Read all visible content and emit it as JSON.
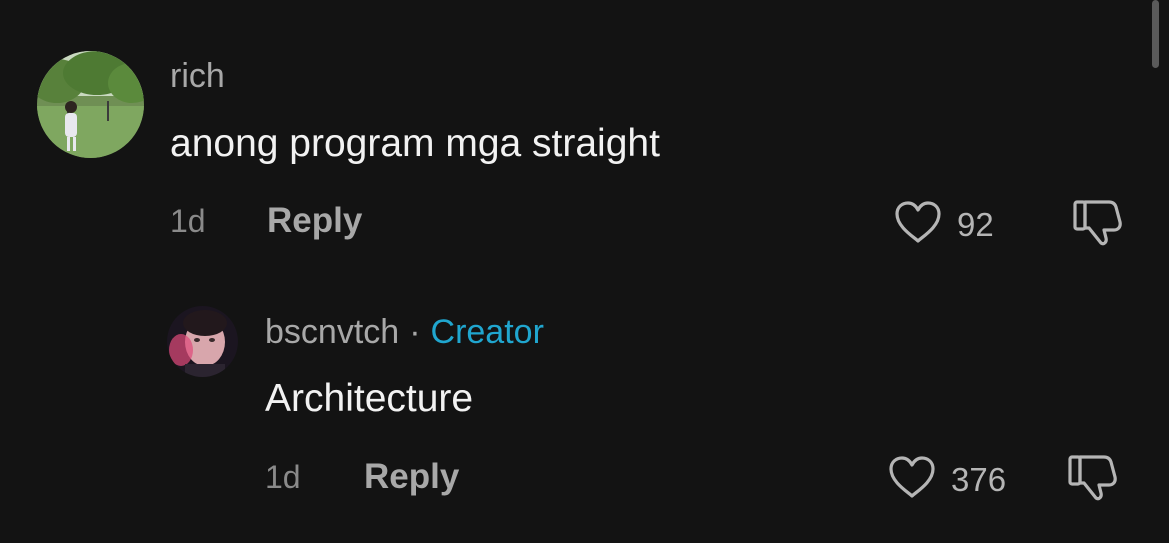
{
  "comments": [
    {
      "username": "rich",
      "text": "anong program mga straight",
      "time": "1d",
      "reply_label": "Reply",
      "likes": "92"
    }
  ],
  "reply": {
    "username": "bscnvtch",
    "separator": "·",
    "badge": "Creator",
    "text": "Architecture",
    "time": "1d",
    "reply_label": "Reply",
    "likes": "376"
  },
  "icons": {
    "like": "heart-icon",
    "dislike": "thumbs-down-icon"
  },
  "colors": {
    "background": "#131313",
    "creator_badge": "#20a6cf",
    "username": "#a8a8a8"
  }
}
